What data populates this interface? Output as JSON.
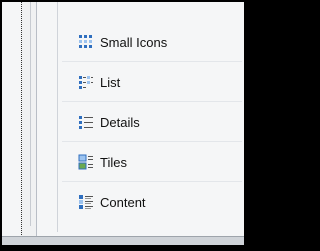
{
  "menu": {
    "items": [
      {
        "label": "Small Icons",
        "icon": "small-icons-view-icon"
      },
      {
        "label": "List",
        "icon": "list-view-icon"
      },
      {
        "label": "Details",
        "icon": "details-view-icon"
      },
      {
        "label": "Tiles",
        "icon": "tiles-view-icon"
      },
      {
        "label": "Content",
        "icon": "content-view-icon"
      }
    ]
  },
  "colors": {
    "icon_blue": "#2f6fbf",
    "icon_light": "#9cc3ef",
    "menu_background": "#f5f6f7",
    "border": "#b9bec6"
  }
}
